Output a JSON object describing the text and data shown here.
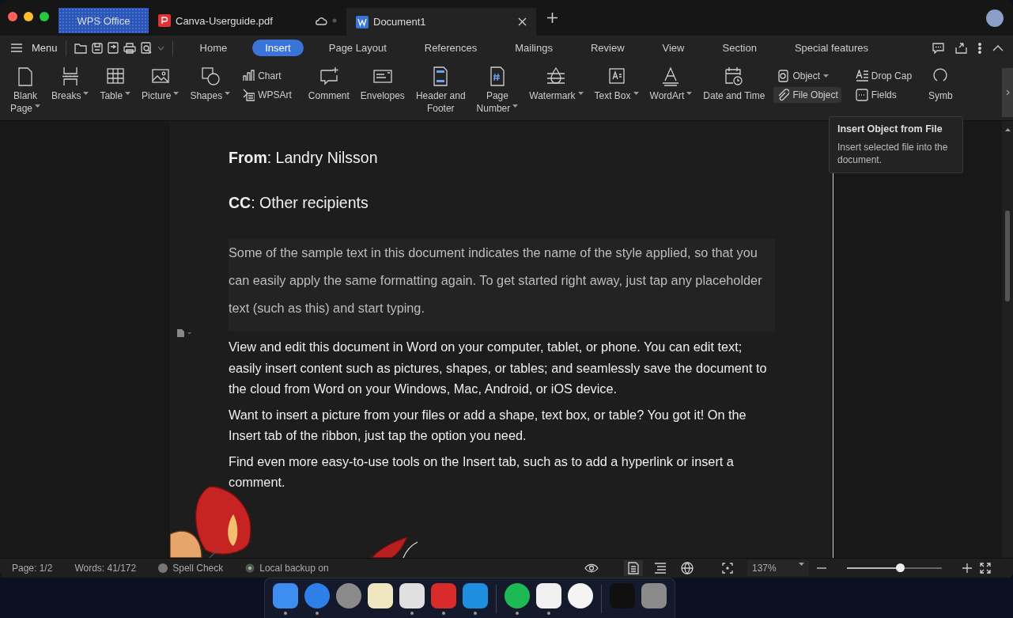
{
  "title_tabs": [
    {
      "label": "WPS Office",
      "kind": "home",
      "selected": false
    },
    {
      "label": "Canva-Userguide.pdf",
      "kind": "pdf",
      "selected": false
    },
    {
      "label": "Document1",
      "kind": "doc",
      "selected": true
    }
  ],
  "menu": {
    "label": "Menu"
  },
  "ribbon_tabs": [
    {
      "label": "Home",
      "selected": false
    },
    {
      "label": "Insert",
      "selected": true
    },
    {
      "label": "Page Layout",
      "selected": false
    },
    {
      "label": "References",
      "selected": false
    },
    {
      "label": "Mailings",
      "selected": false
    },
    {
      "label": "Review",
      "selected": false
    },
    {
      "label": "View",
      "selected": false
    },
    {
      "label": "Section",
      "selected": false
    },
    {
      "label": "Special features",
      "selected": false
    }
  ],
  "tools": [
    {
      "kind": "large",
      "label": "Blank\nPage",
      "dropdown": true
    },
    {
      "kind": "large",
      "label": "Breaks",
      "dropdown": true
    },
    {
      "kind": "large",
      "label": "Table",
      "dropdown": true
    },
    {
      "kind": "large",
      "label": "Picture",
      "dropdown": true
    },
    {
      "kind": "large",
      "label": "Shapes",
      "dropdown": true
    },
    {
      "kind": "pair",
      "items": [
        {
          "label": "Chart",
          "dropdown": false,
          "hovered": false
        },
        {
          "label": "WPSArt",
          "dropdown": false,
          "hovered": false
        }
      ]
    },
    {
      "kind": "large",
      "label": "Comment",
      "dropdown": false
    },
    {
      "kind": "large",
      "label": "Envelopes",
      "dropdown": false
    },
    {
      "kind": "large",
      "label": "Header and\nFooter",
      "dropdown": false
    },
    {
      "kind": "large",
      "label": "Page\nNumber",
      "dropdown": true
    },
    {
      "kind": "large",
      "label": "Watermark",
      "dropdown": true
    },
    {
      "kind": "large",
      "label": "Text Box",
      "dropdown": true
    },
    {
      "kind": "large",
      "label": "WordArt",
      "dropdown": true
    },
    {
      "kind": "large",
      "label": "Date and Time",
      "dropdown": false
    },
    {
      "kind": "pair",
      "items": [
        {
          "label": "Object",
          "dropdown": true,
          "hovered": false
        },
        {
          "label": "File Object",
          "dropdown": false,
          "hovered": true
        }
      ]
    },
    {
      "kind": "pair",
      "items": [
        {
          "label": "Drop Cap",
          "dropdown": false,
          "hovered": false
        },
        {
          "label": "Fields",
          "dropdown": false,
          "hovered": false
        }
      ]
    },
    {
      "kind": "large",
      "label": "Symb",
      "dropdown": false
    }
  ],
  "tooltip": {
    "title": "Insert Object from File",
    "text": "Insert selected file into the document."
  },
  "document": {
    "paragraphs": [
      {
        "kind": "field",
        "text": "**From**: Landry Nilsson"
      },
      {
        "kind": "field",
        "text": "**CC**: Other recipients"
      },
      {
        "kind": "placeholder",
        "text": "Some of the sample text in this document indicates the name of the style applied, so that you can easily apply the same formatting again. To get started right away, just tap any placeholder text (such as this) and start typing."
      },
      {
        "kind": "body",
        "text": "View and edit this document in Word on your computer, tablet, or phone. You can edit text; easily insert content such as pictures, shapes, or tables; and seamlessly save the document to the cloud from Word on your Windows, Mac, Android, or iOS device."
      },
      {
        "kind": "body",
        "text": "Want to insert a picture from your files or add a shape, text box, or table? You got it! On the Insert tab of the ribbon, just tap the option you need."
      },
      {
        "kind": "body",
        "text": "Find even more easy-to-use tools on the Insert tab, such as to add a hyperlink or insert a comment."
      }
    ]
  },
  "status_bar": {
    "page": "Page: 1/2",
    "words": "Words: 41/172",
    "spell_check": "Spell Check",
    "backup": "Local backup on",
    "views": [
      {
        "selected": true
      },
      {
        "selected": false
      },
      {
        "selected": false
      }
    ],
    "zoom": "137%",
    "zoom_slider": {
      "level": 0.56
    }
  },
  "dock": [
    {
      "running": true
    },
    {
      "running": true
    },
    {
      "running": false
    },
    {
      "running": false
    },
    {
      "running": true
    },
    {
      "running": true
    },
    {
      "running": true
    },
    {
      "running": true
    },
    {
      "running": true
    },
    {
      "running": false
    },
    {
      "running": false
    },
    {
      "running": false
    }
  ]
}
